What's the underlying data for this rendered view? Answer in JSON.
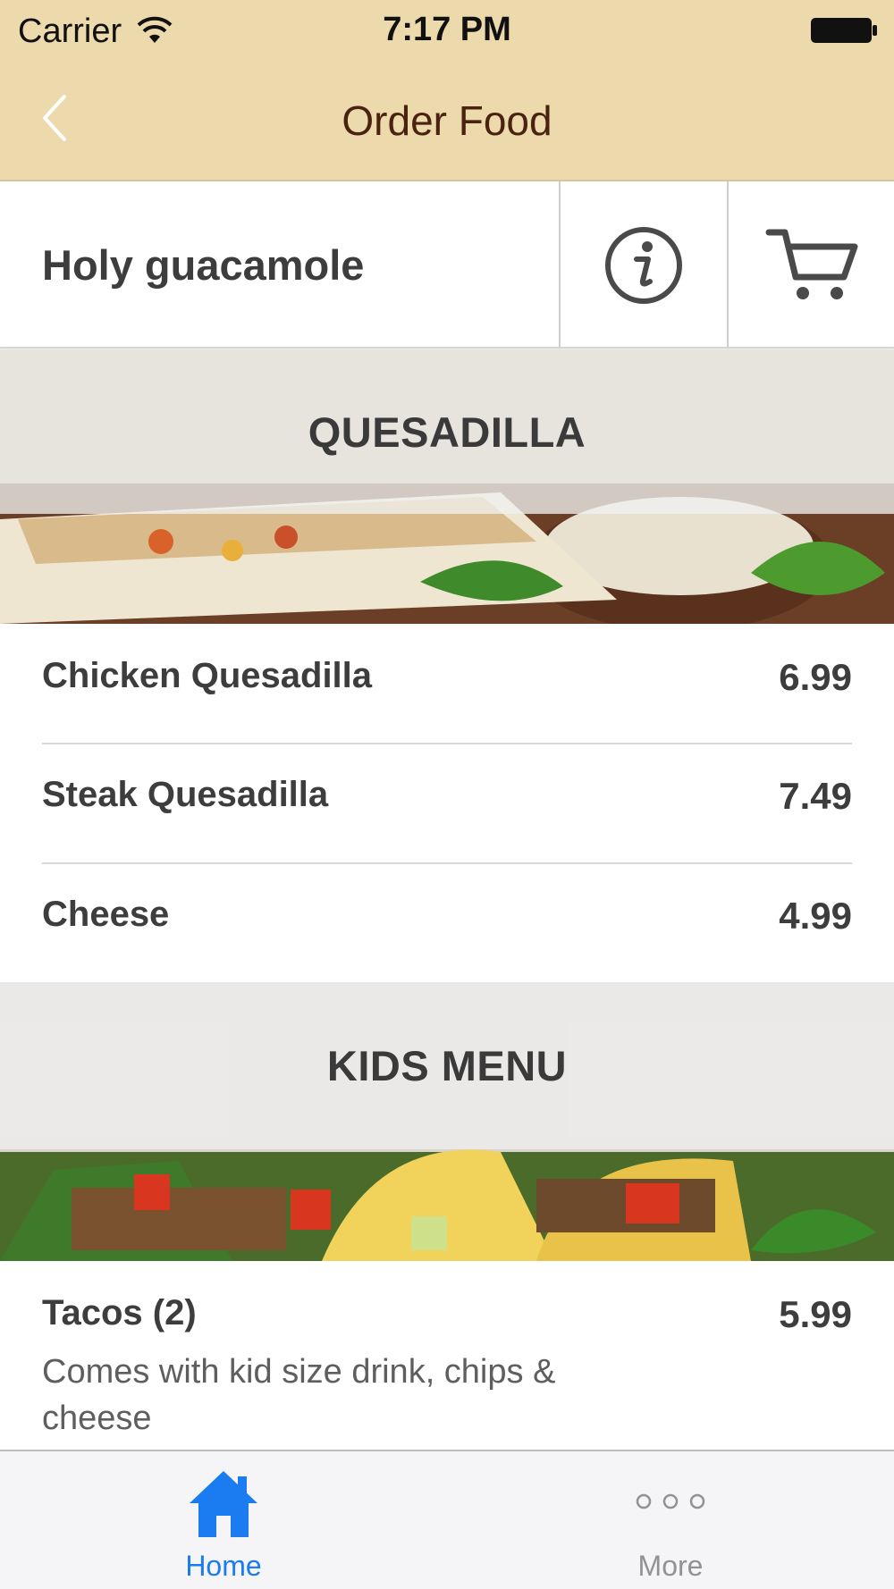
{
  "status_bar": {
    "carrier": "Carrier",
    "time": "7:17 PM"
  },
  "nav": {
    "title": "Order Food",
    "back_icon": "chevron-left-icon"
  },
  "restaurant": {
    "name": "Holy guacamole",
    "info_icon": "info-icon",
    "cart_icon": "cart-icon"
  },
  "sections": [
    {
      "title": "QUESADILLA",
      "items": [
        {
          "name": "Chicken Quesadilla",
          "price": "6.99"
        },
        {
          "name": "Steak Quesadilla",
          "price": "7.49"
        },
        {
          "name": "Cheese",
          "price": "4.99"
        }
      ]
    },
    {
      "title": "KIDS MENU",
      "items": [
        {
          "name": "Tacos (2)",
          "price": "5.99",
          "description": "Comes with kid size drink, chips & cheese"
        }
      ]
    }
  ],
  "tabbar": {
    "tabs": [
      {
        "label": "Home",
        "icon": "home-icon",
        "active": true
      },
      {
        "label": "More",
        "icon": "more-icon",
        "active": false
      }
    ]
  },
  "colors": {
    "nav_bg": "#ecd9ac",
    "nav_title": "#4a2310",
    "active_tab": "#1a7cf0",
    "inactive_tab": "#929292"
  }
}
